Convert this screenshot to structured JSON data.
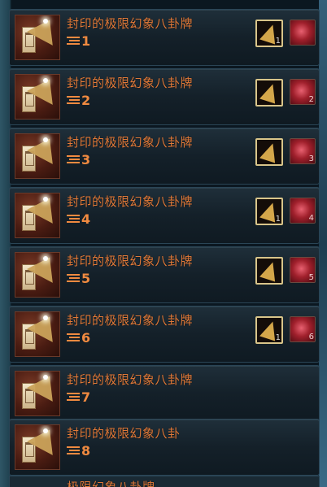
{
  "items": [
    {
      "name": "封印的极限幻象八卦牌",
      "level": "1",
      "slot_count": "1",
      "gem_count": ""
    },
    {
      "name": "封印的极限幻象八卦牌",
      "level": "2",
      "slot_count": "",
      "gem_count": "2"
    },
    {
      "name": "封印的极限幻象八卦牌",
      "level": "3",
      "slot_count": "",
      "gem_count": "3"
    },
    {
      "name": "封印的极限幻象八卦牌",
      "level": "4",
      "slot_count": "1",
      "gem_count": "4"
    },
    {
      "name": "封印的极限幻象八卦牌",
      "level": "5",
      "slot_count": "",
      "gem_count": "5"
    },
    {
      "name": "封印的极限幻象八卦牌",
      "level": "6",
      "slot_count": "1",
      "gem_count": "6"
    },
    {
      "name": "封印的极限幻象八卦牌",
      "level": "7"
    },
    {
      "name": "封印的极限幻象八卦",
      "level": "8"
    }
  ],
  "partial_item": {
    "name": "极限幻象八卦牌"
  },
  "colors": {
    "title": "#e07a3a",
    "level": "#f08a40",
    "slot_border": "#d9c58a"
  },
  "icons": {
    "item_thumb": "bagua-card-icon",
    "slot1": "triangle-shard-icon",
    "slot2": "red-gem-icon",
    "level": "level-bars-icon"
  }
}
